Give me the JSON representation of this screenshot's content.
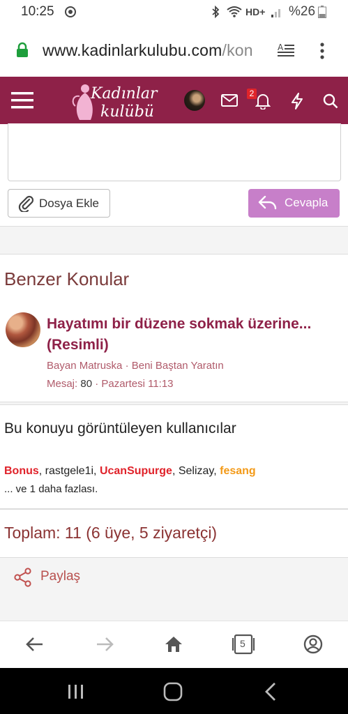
{
  "status_bar": {
    "time": "10:25",
    "signal_label": "HD+",
    "battery": "%26"
  },
  "browser": {
    "url_domain": "www.kadinlarkulubu.com",
    "url_path": "/kon"
  },
  "site": {
    "logo_line1": "Kadınlar",
    "logo_line2": "kulübü",
    "notification_count": "2"
  },
  "reply": {
    "attach_label": "Dosya Ekle",
    "reply_label": "Cevapla"
  },
  "similar": {
    "heading": "Benzer Konular",
    "thread": {
      "title": "Hayatımı bir düzene sokmak üzerine... (Resimli)",
      "author": "Bayan Matruska",
      "forum": "Beni Baştan Yaratın",
      "replies_label": "Mesaj:",
      "replies_count": "80",
      "date": "Pazartesi 11:13"
    }
  },
  "viewers": {
    "heading": "Bu konuyu görüntüleyen kullanıcılar",
    "users": [
      {
        "name": "Bonus",
        "style": "red"
      },
      {
        "name": "rastgele1i",
        "style": "normal"
      },
      {
        "name": "UcanSupurge",
        "style": "red"
      },
      {
        "name": "Selizay",
        "style": "normal"
      },
      {
        "name": "fesang",
        "style": "orange"
      }
    ],
    "more": "... ve 1 daha fazlası."
  },
  "totals": {
    "text": "Toplam: 11 (6 üye, 5 ziyaretçi)"
  },
  "share": {
    "label": "Paylaş"
  },
  "bottom_nav": {
    "tab_count": "5",
    "icons": [
      "back-arrow-icon",
      "forward-arrow-icon",
      "home-icon",
      "tabs-icon",
      "account-icon"
    ]
  },
  "colors": {
    "header_bg": "#8e2148",
    "reply_button": "#c77fc9",
    "thread_title": "#8e2148",
    "user_red": "#e0222a",
    "user_orange": "#f39a18"
  }
}
